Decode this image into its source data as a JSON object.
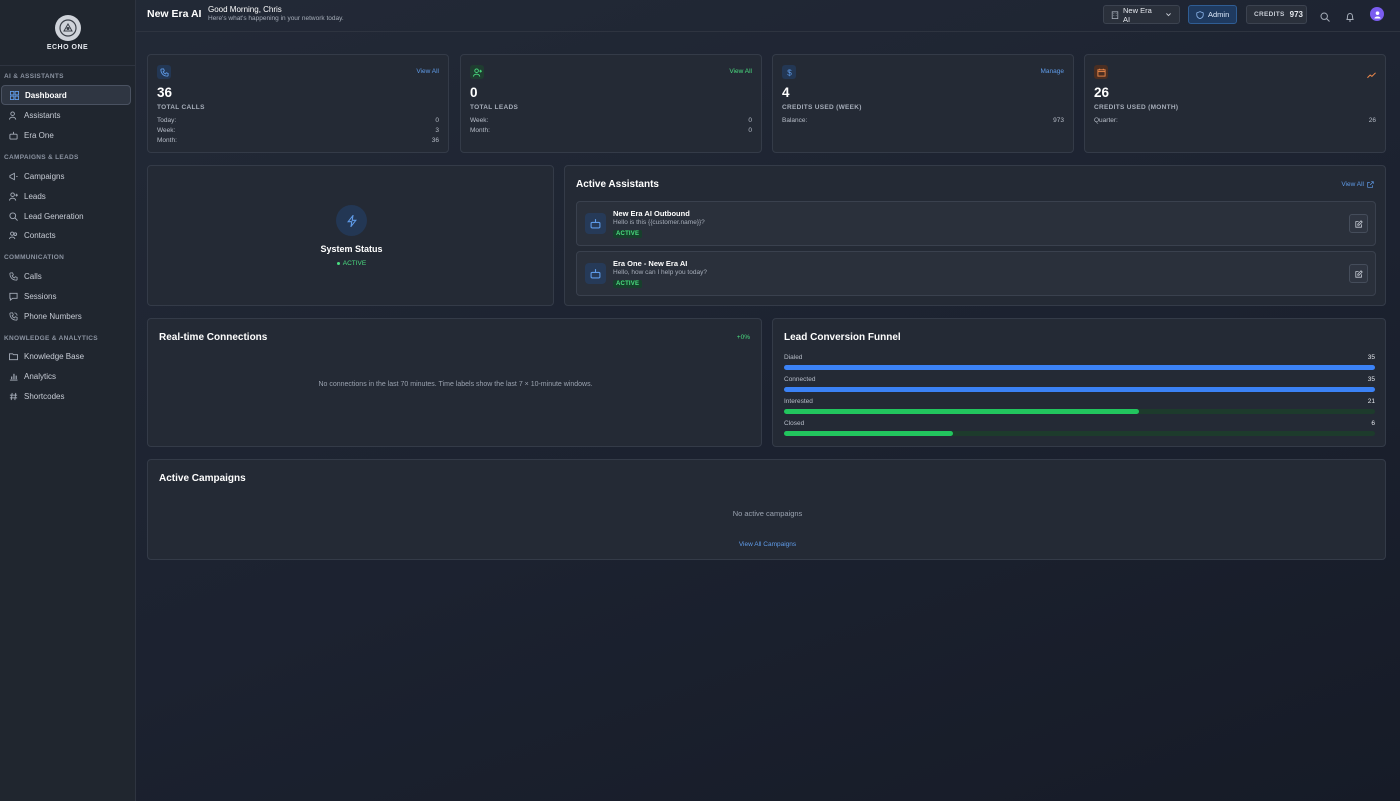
{
  "logo": {
    "text": "ECHO ONE"
  },
  "sidebar": {
    "sections": [
      {
        "label": "AI & ASSISTANTS"
      },
      {
        "label": "CAMPAIGNS & LEADS"
      },
      {
        "label": "COMMUNICATION"
      },
      {
        "label": "KNOWLEDGE & ANALYTICS"
      }
    ],
    "items": [
      {
        "label": "Dashboard",
        "icon": "grid-icon",
        "active": true
      },
      {
        "label": "Assistants",
        "icon": "users-icon"
      },
      {
        "label": "Era One",
        "icon": "bot-icon"
      },
      {
        "label": "Campaigns",
        "icon": "megaphone-icon"
      },
      {
        "label": "Leads",
        "icon": "user-plus-icon"
      },
      {
        "label": "Lead Generation",
        "icon": "search-icon"
      },
      {
        "label": "Contacts",
        "icon": "contacts-icon"
      },
      {
        "label": "Calls",
        "icon": "phone-icon"
      },
      {
        "label": "Sessions",
        "icon": "chat-icon"
      },
      {
        "label": "Phone Numbers",
        "icon": "phone-call-icon"
      },
      {
        "label": "Knowledge Base",
        "icon": "folder-icon"
      },
      {
        "label": "Analytics",
        "icon": "bar-chart-icon"
      },
      {
        "label": "Shortcodes",
        "icon": "hash-icon"
      }
    ]
  },
  "header": {
    "title": "New Era AI",
    "greeting": "Good Morning, Chris",
    "subtitle": "Here's what's happening in your network today.",
    "org_label": "New Era AI",
    "admin_label": "Admin",
    "credits_label": "CREDITS",
    "credits_value": "973"
  },
  "stats": [
    {
      "value": "36",
      "label": "TOTAL CALLS",
      "link": "View All",
      "icon": "phone-icon",
      "accent": "#5f9be8",
      "rows": [
        {
          "k": "Today:",
          "v": "0"
        },
        {
          "k": "Week:",
          "v": "3"
        },
        {
          "k": "Month:",
          "v": "36"
        }
      ]
    },
    {
      "value": "0",
      "label": "TOTAL LEADS",
      "link": "View All",
      "icon": "user-plus-icon",
      "accent": "#4ade80",
      "rows": [
        {
          "k": "Week:",
          "v": "0"
        },
        {
          "k": "Month:",
          "v": "0"
        }
      ]
    },
    {
      "value": "4",
      "label": "CREDITS USED (WEEK)",
      "link": "Manage",
      "icon": "dollar-icon",
      "accent": "#5f9be8",
      "rows": [
        {
          "k": "Balance:",
          "v": "973"
        }
      ]
    },
    {
      "value": "26",
      "label": "CREDITS USED (MONTH)",
      "link": "",
      "icon": "calendar-icon",
      "accent": "#f08a4b",
      "rows": [
        {
          "k": "Quarter:",
          "v": "26"
        }
      ]
    }
  ],
  "system_status": {
    "title": "System Status",
    "status": "ACTIVE"
  },
  "active_assistants": {
    "title": "Active Assistants",
    "link": "View All",
    "items": [
      {
        "name": "New Era AI Outbound",
        "message": "Hello is this {{customer.name}}?",
        "status": "ACTIVE"
      },
      {
        "name": "Era One - New Era AI",
        "message": "Hello, how can I help you today?",
        "status": "ACTIVE"
      }
    ]
  },
  "realtime": {
    "title": "Real-time Connections",
    "change": "+0%",
    "empty": "No connections in the last 70 minutes. Time labels show the last 7 × 10-minute windows."
  },
  "funnel": {
    "title": "Lead Conversion Funnel",
    "stages": [
      {
        "label": "Dialed",
        "value": 35,
        "fraction": 1.0,
        "color": "#3b82f6"
      },
      {
        "label": "Connected",
        "value": 35,
        "fraction": 1.0,
        "color": "#3b82f6"
      },
      {
        "label": "Interested",
        "value": 21,
        "fraction": 0.6,
        "color": "#22c55e"
      },
      {
        "label": "Closed",
        "value": 6,
        "fraction": 0.286,
        "color": "#22c55e"
      }
    ]
  },
  "campaigns": {
    "title": "Active Campaigns",
    "empty": "No active campaigns",
    "link": "View All Campaigns"
  }
}
